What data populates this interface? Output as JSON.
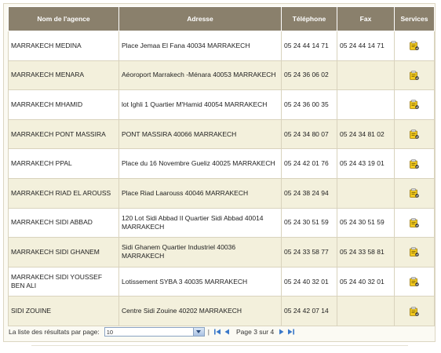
{
  "table": {
    "headers": [
      "Nom de l'agence",
      "Adresse",
      "Téléphone",
      "Fax",
      "Services"
    ],
    "rows": [
      {
        "name": "MARRAKECH MEDINA",
        "address": "Place Jemaa El Fana 40034 MARRAKECH",
        "phone": "05 24 44 14 71",
        "fax": "05 24 44 14 71"
      },
      {
        "name": "MARRAKECH MENARA",
        "address": "Aéoroport Marrakech -Ménara 40053 MARRAKECH",
        "phone": "05 24 36 06 02",
        "fax": ""
      },
      {
        "name": "MARRAKECH MHAMID",
        "address": "lot Ighli 1 Quartier M'Hamid 40054 MARRAKECH",
        "phone": "05 24 36 00 35",
        "fax": ""
      },
      {
        "name": "MARRAKECH PONT MASSIRA",
        "address": "PONT MASSIRA 40066 MARRAKECH",
        "phone": "05 24 34 80 07",
        "fax": "05 24 34 81 02"
      },
      {
        "name": "MARRAKECH PPAL",
        "address": "Place du 16 Novembre Gueliz 40025 MARRAKECH",
        "phone": "05 24 42 01 76",
        "fax": "05 24 43 19 01"
      },
      {
        "name": "MARRAKECH RIAD EL AROUSS",
        "address": "Place Riad Laarouss 40046 MARRAKECH",
        "phone": "05 24 38 24 94",
        "fax": ""
      },
      {
        "name": "MARRAKECH SIDI ABBAD",
        "address": "120 Lot Sidi Abbad II Quartier Sidi Abbad 40014 MARRAKECH",
        "phone": "05 24 30 51 59",
        "fax": "05 24 30 51 59"
      },
      {
        "name": "MARRAKECH SIDI GHANEM",
        "address": "Sidi Ghanem Quartier Industriel 40036 MARRAKECH",
        "phone": "05 24 33 58 77",
        "fax": "05 24 33 58 81"
      },
      {
        "name": "MARRAKECH SIDI YOUSSEF BEN ALI",
        "address": "Lotissement SYBA 3 40035 MARRAKECH",
        "phone": "05 24 40 32 01",
        "fax": "05 24 40 32 01"
      },
      {
        "name": "SIDI ZOUINE",
        "address": "Centre Sidi Zouine 40202 MARRAKECH",
        "phone": "05 24 42 07 14",
        "fax": ""
      }
    ],
    "service_icon": "services-icon"
  },
  "pager": {
    "label": "La liste des résultats par page:",
    "page_size": "10",
    "separator": "|",
    "page_info": "Page 3 sur 4"
  },
  "colors": {
    "header_bg": "#8a806c",
    "row_alt": "#f3f0dc",
    "border": "#d9d3bd",
    "nav_blue": "#3a78c9"
  }
}
